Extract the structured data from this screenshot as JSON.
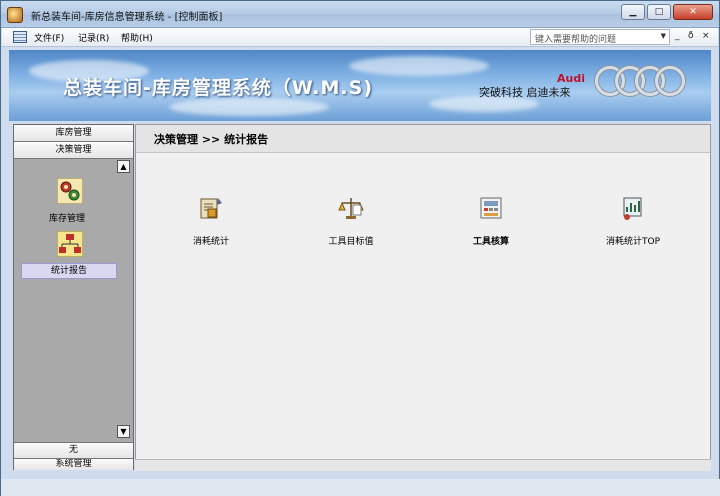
{
  "window": {
    "title": "新总装车间-库房信息管理系统 - [控制面板]",
    "controls": {
      "minimize": "▁",
      "maximize": "□",
      "close": "✕"
    }
  },
  "menubar": {
    "items": [
      "文件(F)",
      "记录(R)",
      "帮助(H)"
    ],
    "help_placeholder": "键入需要帮助的问题",
    "mdi_controls": [
      "_",
      "ð",
      "×"
    ]
  },
  "banner": {
    "title": "总装车间-库房管理系统（W.M.S)",
    "brand": "Audi",
    "slogan": "突破科技 启迪未来"
  },
  "sidebar": {
    "groups": [
      "库房管理",
      "决策管理"
    ],
    "items": [
      {
        "label": "库存管理",
        "icon": "gears-icon"
      },
      {
        "label": "统计报告",
        "icon": "org-chart-icon",
        "selected": true
      }
    ],
    "footer": [
      "无",
      "系统管理"
    ],
    "scroll_up": "▲",
    "scroll_down": "▼"
  },
  "main": {
    "breadcrumb": "决策管理 >> 统计报告",
    "tools": [
      {
        "label": "消耗统计",
        "icon": "consumption-stats-icon",
        "bold": false
      },
      {
        "label": "工具目标值",
        "icon": "scale-icon",
        "bold": false
      },
      {
        "label": "工具核算",
        "icon": "calculation-icon",
        "bold": true
      },
      {
        "label": "消耗统计TOP",
        "icon": "top-stats-icon",
        "bold": false
      }
    ]
  },
  "colors": {
    "selected_nav": "#d8d8f0",
    "banner_sky": "#7fb0e4",
    "audi_red": "#c0102a"
  }
}
